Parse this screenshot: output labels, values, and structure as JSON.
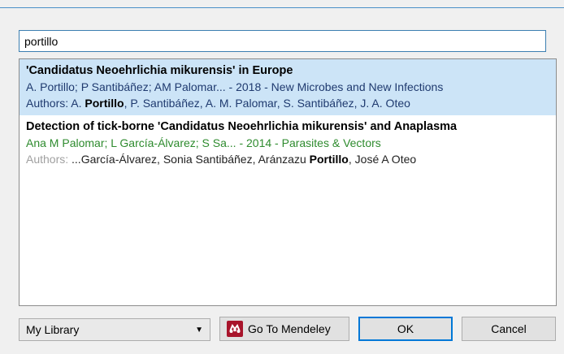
{
  "search": {
    "value": "portillo"
  },
  "results": [
    {
      "title": "'Candidatus Neoehrlichia mikurensis' in Europe",
      "meta": "A. Portillo; P Santibáñez; AM Palomar... - 2018 - New Microbes and New Infections",
      "authors_label": "Authors: ",
      "authors_pre": "A. ",
      "authors_bold": "Portillo",
      "authors_post": ", P. Santibáñez, A. M. Palomar, S. Santibáñez, J. A. Oteo"
    },
    {
      "title": "Detection of tick-borne 'Candidatus Neoehrlichia mikurensis' and Anaplasma",
      "meta": "Ana M Palomar; L García-Álvarez; S Sa... - 2014 - Parasites & Vectors",
      "authors_label": "Authors: ",
      "authors_pre": "...García-Álvarez, Sonia Santibáñez, Aránzazu ",
      "authors_bold": "Portillo",
      "authors_post": ", José A Oteo"
    }
  ],
  "footer": {
    "library_selected": "My Library",
    "go_to_mendeley": "Go To Mendeley",
    "ok": "OK",
    "cancel": "Cancel"
  },
  "colors": {
    "accent": "#0078d7",
    "selection": "#cce4f7",
    "mendeley_brand": "#a8142b"
  },
  "icons": {
    "dropdown": "chevron-down-icon",
    "brand": "mendeley-logo-icon"
  }
}
